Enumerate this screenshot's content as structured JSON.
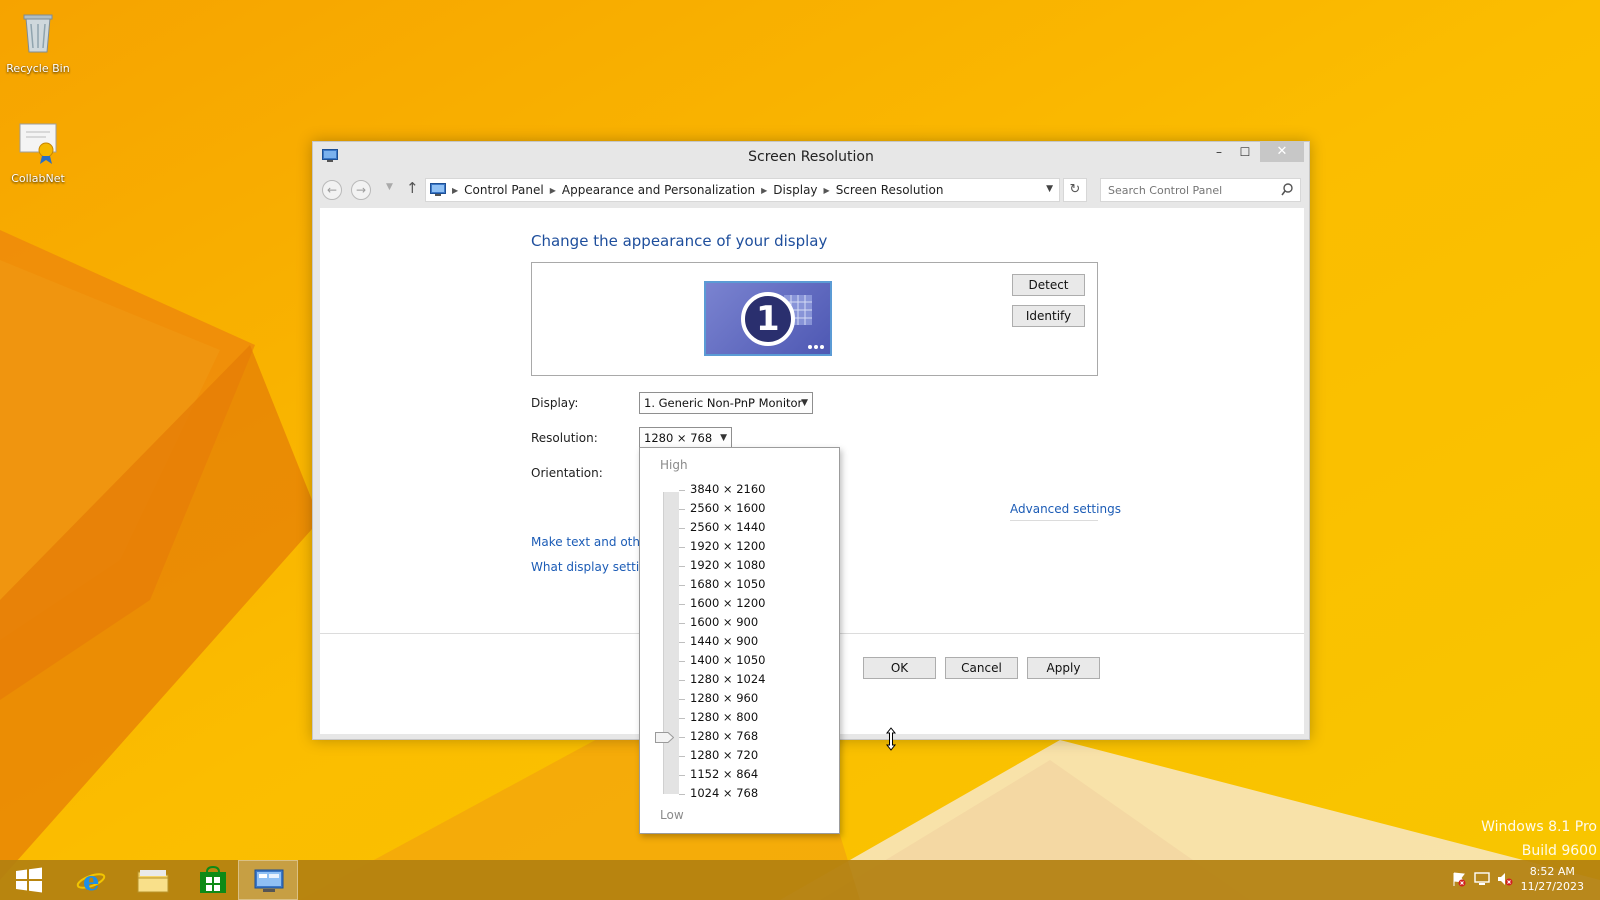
{
  "desktop": {
    "icons": [
      {
        "label": "Recycle Bin"
      },
      {
        "label": "CollabNet"
      }
    ],
    "watermark": {
      "line1": "Windows 8.1 Pro",
      "line2": "Build 9600"
    }
  },
  "window": {
    "title": "Screen Resolution",
    "controls": {
      "minimize": "–",
      "maximize": "☐",
      "close": "✕"
    },
    "breadcrumb": [
      "Control Panel",
      "Appearance and Personalization",
      "Display",
      "Screen Resolution"
    ],
    "search_placeholder": "Search Control Panel",
    "heading": "Change the appearance of your display",
    "monitor_number": "1",
    "detect_label": "Detect",
    "identify_label": "Identify",
    "display_label": "Display:",
    "display_value": "1. Generic Non-PnP Monitor",
    "resolution_label": "Resolution:",
    "resolution_value": "1280 × 768",
    "orientation_label": "Orientation:",
    "advanced_link": "Advanced settings",
    "link_text_size": "Make text and other",
    "link_display_settings": "What display setting",
    "ok_label": "OK",
    "cancel_label": "Cancel",
    "apply_label": "Apply"
  },
  "resolution_dropdown": {
    "high_label": "High",
    "low_label": "Low",
    "selected_index": 13,
    "items": [
      "3840 × 2160",
      "2560 × 1600",
      "2560 × 1440",
      "1920 × 1200",
      "1920 × 1080",
      "1680 × 1050",
      "1600 × 1200",
      "1600 × 900",
      "1440 × 900",
      "1400 × 1050",
      "1280 × 1024",
      "1280 × 960",
      "1280 × 800",
      "1280 × 768",
      "1280 × 720",
      "1152 × 864",
      "1024 × 768"
    ]
  },
  "taskbar": {
    "apps": [
      "start-button",
      "internet-explorer",
      "file-explorer",
      "store",
      "control-panel"
    ],
    "time": "8:52 AM",
    "date": "11/27/2023"
  }
}
